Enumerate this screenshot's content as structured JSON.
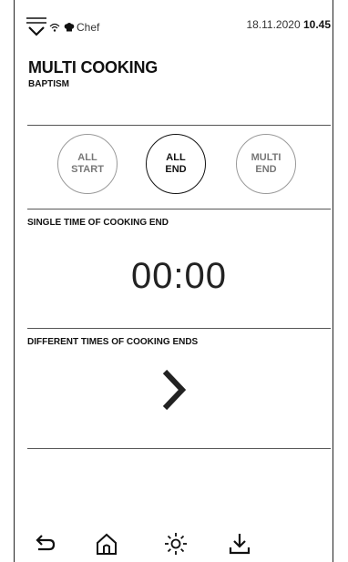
{
  "status_bar": {
    "user_name": "Chef",
    "date": "18.11.2020",
    "time": "10.45",
    "icons": [
      "menu-chevron-icon",
      "wifi-icon",
      "chef-hat-icon"
    ]
  },
  "header": {
    "title": "MULTI COOKING",
    "subtitle": "BAPTISM"
  },
  "mode_buttons": [
    {
      "line1": "ALL",
      "line2": "START",
      "selected": false
    },
    {
      "line1": "ALL",
      "line2": "END",
      "selected": true
    },
    {
      "line1": "MULTI",
      "line2": "END",
      "selected": false
    }
  ],
  "single_time": {
    "label": "SINGLE TIME OF COOKING END",
    "value": "00:00"
  },
  "different_times": {
    "label": "DIFFERENT TIMES OF COOKING ENDS",
    "icon": "chevron-right-icon"
  },
  "bottom_nav": {
    "icons": [
      "back-arrow-icon",
      "home-icon",
      "light-icon",
      "download-icon"
    ]
  },
  "colors": {
    "background": "#ffffff",
    "text": "#111111",
    "inactive": "#999999",
    "divider": "#555555"
  }
}
